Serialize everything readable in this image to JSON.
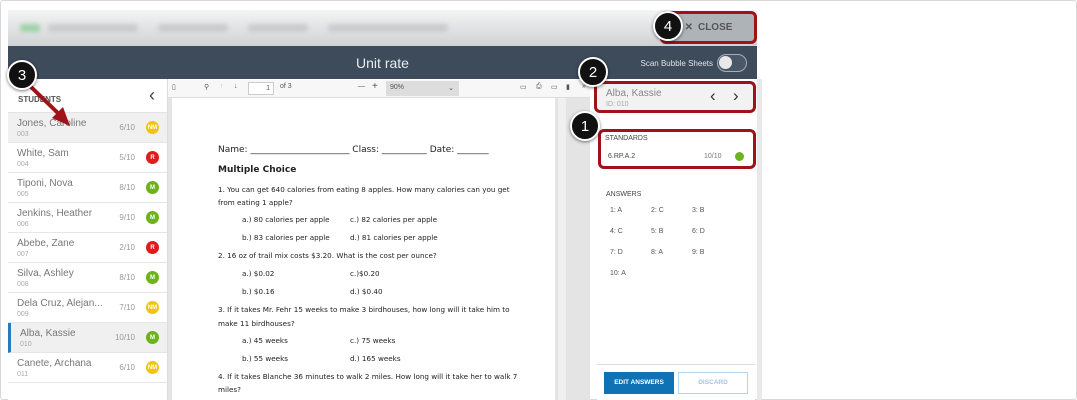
{
  "header": {
    "close_label": "CLOSE",
    "title": "Unit rate",
    "scan_label": "Scan Bubble Sheets"
  },
  "students": {
    "label": "STUDENTS",
    "items": [
      {
        "name": "Jones, Caroline",
        "id": "003",
        "score": "6/10",
        "badge": "NM"
      },
      {
        "name": "White, Sam",
        "id": "004",
        "score": "5/10",
        "badge": "R"
      },
      {
        "name": "Tiponi, Nova",
        "id": "005",
        "score": "8/10",
        "badge": "M"
      },
      {
        "name": "Jenkins, Heather",
        "id": "006",
        "score": "9/10",
        "badge": "M"
      },
      {
        "name": "Abebe, Zane",
        "id": "007",
        "score": "2/10",
        "badge": "R"
      },
      {
        "name": "Silva, Ashley",
        "id": "008",
        "score": "8/10",
        "badge": "M"
      },
      {
        "name": "Dela Cruz, Alejan...",
        "id": "009",
        "score": "7/10",
        "badge": "NM"
      },
      {
        "name": "Alba, Kassie",
        "id": "010",
        "score": "10/10",
        "badge": "M"
      },
      {
        "name": "Canete, Archana",
        "id": "011",
        "score": "6/10",
        "badge": "NM"
      }
    ]
  },
  "badge_colors": {
    "NM": "#f2c40f",
    "R": "#e01b1b",
    "M": "#6db31e"
  },
  "viewer": {
    "page": "1",
    "of": "of 3",
    "zoom": "90%"
  },
  "document": {
    "header_line": "Name: ______________________ Class: __________ Date: _______",
    "section": "Multiple Choice",
    "lines": [
      "1. You can get 640 calories from eating 8 apples. How many calories can you get",
      "from eating 1 apple?",
      "a.) 80 calories per apple",
      "c.) 82 calories per apple",
      "b.) 83 calories per apple",
      "d.) 81 calories per apple",
      "2. 16 oz of trail mix costs $3.20. What is the cost per ounce?",
      "a.) $0.02",
      "c.)$0.20",
      "b.) $0.16",
      "d.) $0.40",
      "3. If it takes Mr. Fehr 15 weeks to make 3 birdhouses, how long will it take him to",
      "make 11 birdhouses?",
      "a.) 45 weeks",
      "c.) 75 weeks",
      "b.) 55 weeks",
      "d.) 165 weeks",
      "4. If it takes Blanche 36 minutes to walk 2 miles. How long will it take her to walk 7",
      "miles?"
    ]
  },
  "current_student": {
    "name": "Alba, Kassie",
    "id": "ID: 010"
  },
  "standards": {
    "label": "STANDARDS",
    "code": "6.RP.A.2",
    "score": "10/10"
  },
  "answers": {
    "label": "ANSWERS",
    "items": [
      "1: A",
      "2: C",
      "3: B",
      "4: C",
      "5: B",
      "6: D",
      "7: D",
      "8: A",
      "9: B",
      "10: A"
    ]
  },
  "buttons": {
    "edit": "EDIT ANSWERS",
    "discard": "DISCARD"
  },
  "callouts": [
    "1",
    "2",
    "3",
    "4"
  ]
}
